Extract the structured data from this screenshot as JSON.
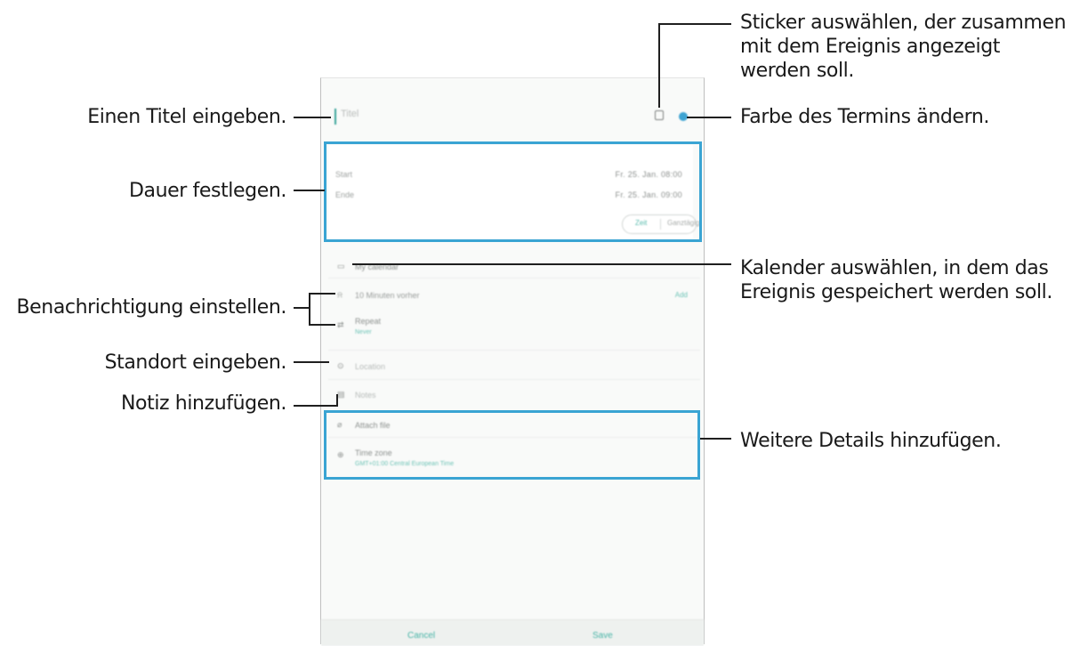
{
  "callouts": {
    "sticker": [
      "Sticker auswählen, der zusammen",
      "mit dem Ereignis angezeigt",
      "werden soll."
    ],
    "title": "Einen Titel eingeben.",
    "color": "Farbe des Termins ändern.",
    "duration": "Dauer festlegen.",
    "calendar": [
      "Kalender auswählen, in dem das",
      "Ereignis gespeichert werden soll."
    ],
    "notification": "Benachrichtigung einstellen.",
    "location": "Standort eingeben.",
    "note": "Notiz hinzufügen.",
    "details": "Weitere Details hinzufügen."
  },
  "screen": {
    "title_placeholder": "Titel",
    "start_label": "Start",
    "start_value": "Fr. 25. Jan. 08:00",
    "end_label": "Ende",
    "end_value": "Fr. 25. Jan. 09:00",
    "toggle_left": "Zeit",
    "toggle_right": "Ganztägig",
    "calendar_value": "My calendar",
    "reminder_value": "10 Minuten vorher",
    "reminder_action": "Add",
    "repeat_value": "Repeat",
    "repeat_sub": "Never",
    "location_placeholder": "Location",
    "notes_placeholder": "Notes",
    "attach_value": "Attach file",
    "timezone_value": "Time zone",
    "timezone_sub": "GMT+01:00 Central European Time",
    "cancel": "Cancel",
    "save": "Save"
  },
  "colors": {
    "highlight": "#3aa4d3",
    "accent": "#3aa59a",
    "event_color": "#3ea3d2"
  }
}
